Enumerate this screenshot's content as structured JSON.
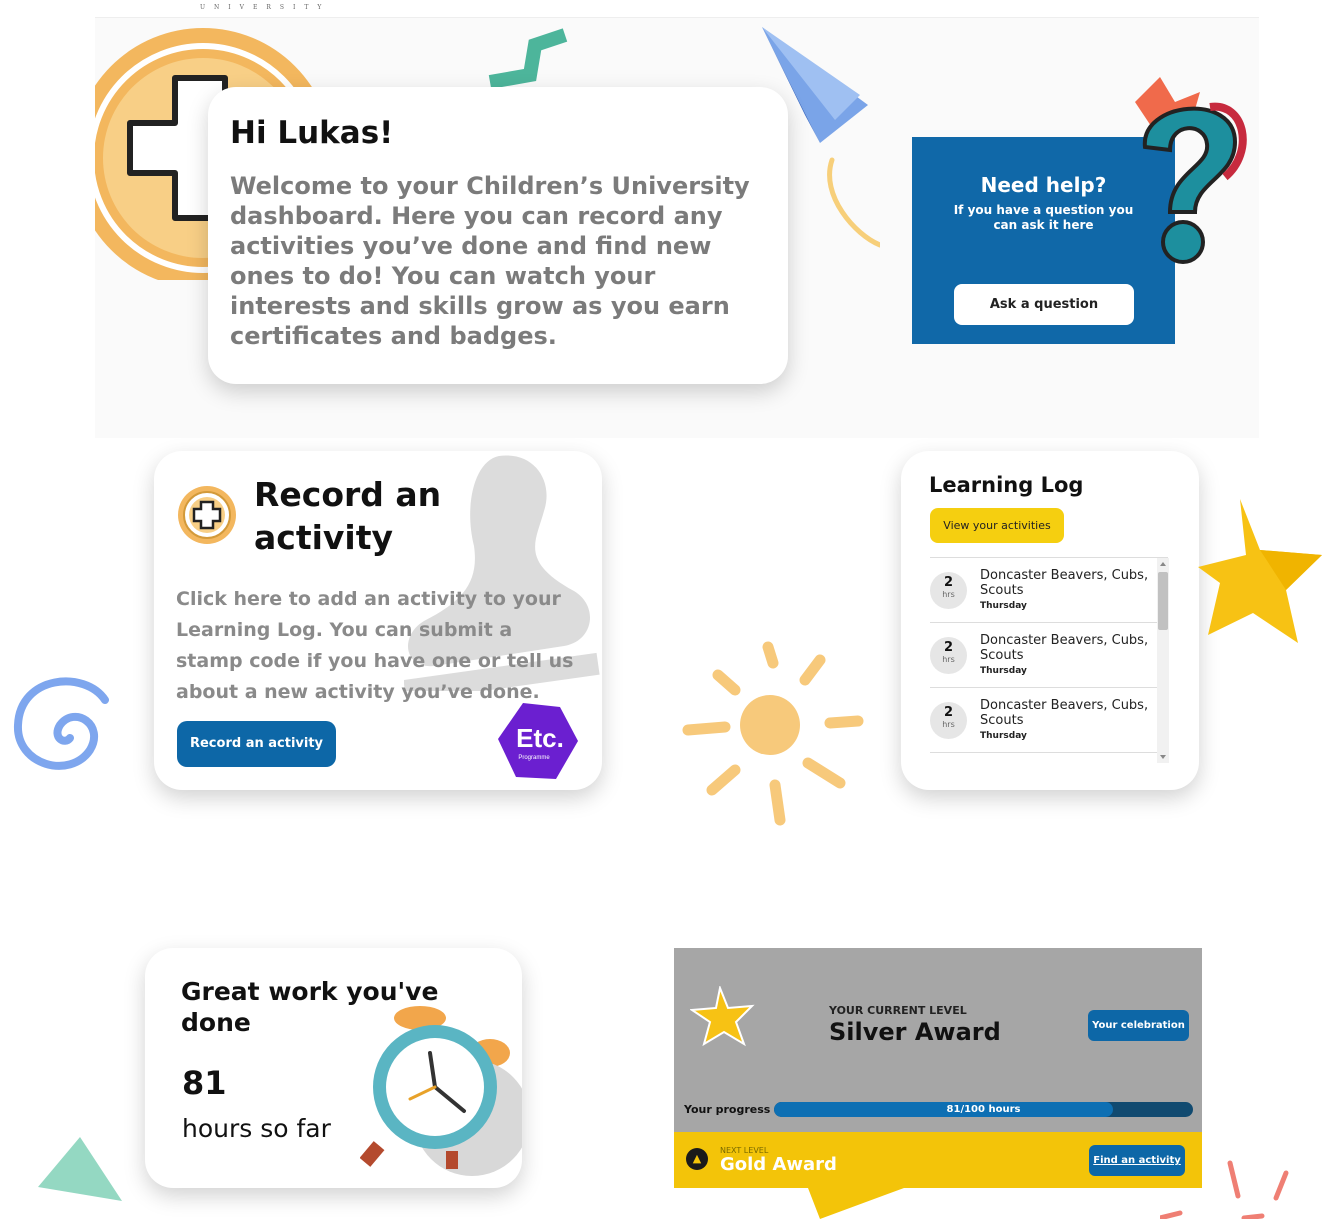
{
  "header": {
    "brand_text": "UNIVERSITY"
  },
  "welcome": {
    "title": "Hi Lukas!",
    "body": "Welcome to your Children’s University dashboard. Here you can record any activities you’ve done and find new ones to do! You can watch your interests and skills grow as you earn certificates and badges."
  },
  "help": {
    "title": "Need help?",
    "subtitle": "If you have a question you can ask it here",
    "button_label": "Ask a question"
  },
  "record": {
    "title_line1": "Record an",
    "title_line2": "activity",
    "body": "Click here to add an activity to your Learning Log. You can submit a stamp code if you have one or tell us about a new activity you’ve done.",
    "button_label": "Record an activity",
    "badge_text": "Etc.",
    "badge_sub": "Programme"
  },
  "learning_log": {
    "title": "Learning Log",
    "button_label": "View your activities",
    "items": [
      {
        "hours": "2",
        "unit": "hrs",
        "name": "Doncaster Beavers, Cubs, Scouts",
        "day": "Thursday"
      },
      {
        "hours": "2",
        "unit": "hrs",
        "name": "Doncaster Beavers, Cubs, Scouts",
        "day": "Thursday"
      },
      {
        "hours": "2",
        "unit": "hrs",
        "name": "Doncaster Beavers, Cubs, Scouts",
        "day": "Thursday"
      }
    ]
  },
  "great_work": {
    "title": "Great work you've done",
    "hours": "81",
    "label": "hours so far"
  },
  "level": {
    "eyebrow": "YOUR CURRENT LEVEL",
    "name": "Silver Award",
    "celebration_button": "Your celebration",
    "progress_label": "Your progress",
    "progress_text": "81/100 hours",
    "progress_fraction": 0.81,
    "next_eyebrow": "NEXT LEVEL",
    "next_name": "Gold Award",
    "find_button": "Find an activity"
  },
  "colors": {
    "primary_blue": "#0d67a7",
    "accent_yellow": "#f5cf10",
    "level_grey": "#a6a6a6"
  }
}
